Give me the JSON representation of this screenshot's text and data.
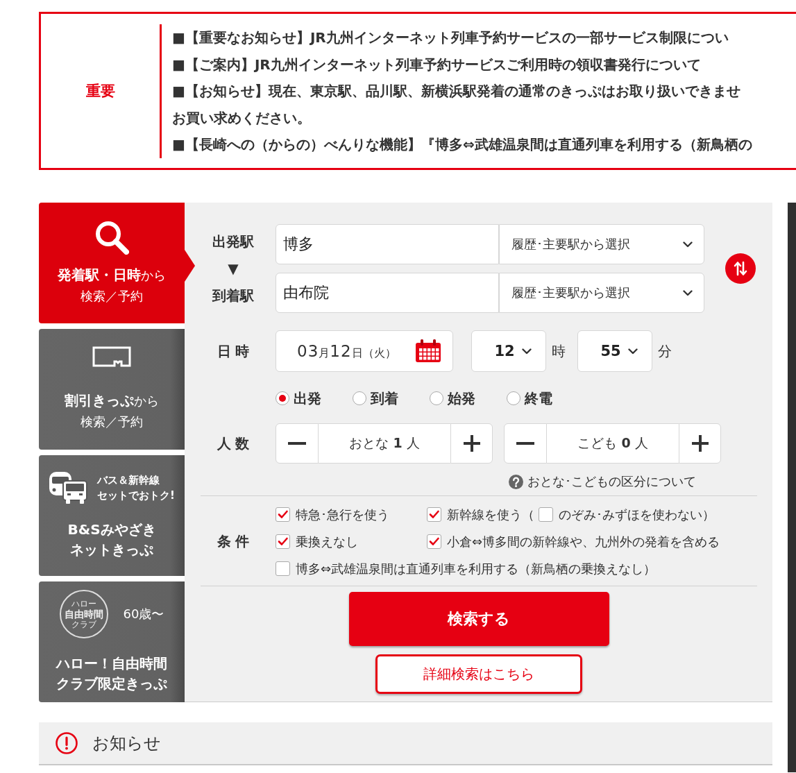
{
  "notice": {
    "label": "重要",
    "lines": [
      "■【重要なお知らせ】JR九州インターネット列車予約サービスの一部サービス制限につい",
      "■【ご案内】JR九州インターネット列車予約サービスご利用時の領収書発行について",
      "■【お知らせ】現在、東京駅、品川駅、新横浜駅発着の通常のきっぷはお取り扱いできませ",
      "お買い求めください。",
      "■【長崎への（からの）べんりな機能】『博多⇔武雄温泉間は直通列車を利用する（新鳥栖の"
    ]
  },
  "sidebar": {
    "tabs": [
      {
        "kind": "station",
        "selected": true,
        "title_lines": [
          "**発着駅・日時**から",
          "検索／予約"
        ]
      },
      {
        "kind": "discount",
        "selected": false,
        "title_lines": [
          "**割引きっぷ**から",
          "検索／予約"
        ]
      },
      {
        "kind": "bus_set",
        "selected": false,
        "badge_lines": [
          "バス＆新幹線",
          "セットでおトク!"
        ],
        "title_lines": [
          "B&Sみやざき",
          "ネットきっぷ"
        ]
      },
      {
        "kind": "club",
        "selected": false,
        "stamp_lines": [
          "ハロー",
          "自由時間",
          "クラブ"
        ],
        "badge_lines": [
          "60歳〜"
        ],
        "title_lines": [
          "ハロー！自由時間",
          "クラブ限定きっぷ"
        ]
      }
    ]
  },
  "search_form": {
    "stations": [
      {
        "label": "出発駅",
        "value": "博多",
        "select": "履歴･主要駅から選択"
      },
      {
        "label": "到着駅",
        "value": "由布院",
        "select": "履歴･主要駅から選択"
      }
    ],
    "direction_arrow": "▼",
    "datetime": {
      "label": "日 時",
      "date_parts": [
        {
          "kind": "number",
          "text": "03"
        },
        {
          "kind": "unit",
          "text": "月"
        },
        {
          "kind": "number",
          "text": "12"
        },
        {
          "kind": "unit",
          "text": "日"
        },
        {
          "kind": "unit",
          "text": "（火）"
        }
      ],
      "hour": "12",
      "hour_unit": "時",
      "minute": "55",
      "minute_unit": "分"
    },
    "time_types": [
      {
        "label": "出発",
        "selected": true
      },
      {
        "label": "到着",
        "selected": false
      },
      {
        "label": "始発",
        "selected": false
      },
      {
        "label": "終電",
        "selected": false
      }
    ],
    "passengers": {
      "label": "人 数",
      "counters": [
        {
          "text": "おとな **1** 人"
        },
        {
          "text": "こども **0** 人"
        }
      ],
      "help": "おとな･こどもの区分について"
    },
    "conditions": {
      "label": "条 件",
      "rows": [
        [
          {
            "label": "特急･急行を使う",
            "checked": true
          },
          {
            "label": "新幹線を使う（",
            "checked": true,
            "sub": {
              "label": "のぞみ･みずほを使わない）",
              "checked": false
            }
          }
        ],
        [
          {
            "label": "乗換えなし",
            "checked": true
          },
          {
            "label": "小倉⇔博多間の新幹線や、九州外の発着を含める",
            "checked": true
          }
        ],
        [
          {
            "label": "博多⇔武雄温泉間は直通列車を利用する（新鳥栖の乗換えなし）",
            "checked": false
          }
        ]
      ]
    },
    "search_button": "検索する",
    "detail_button": "詳細検索はこちら"
  },
  "news": {
    "title": "お知らせ"
  }
}
